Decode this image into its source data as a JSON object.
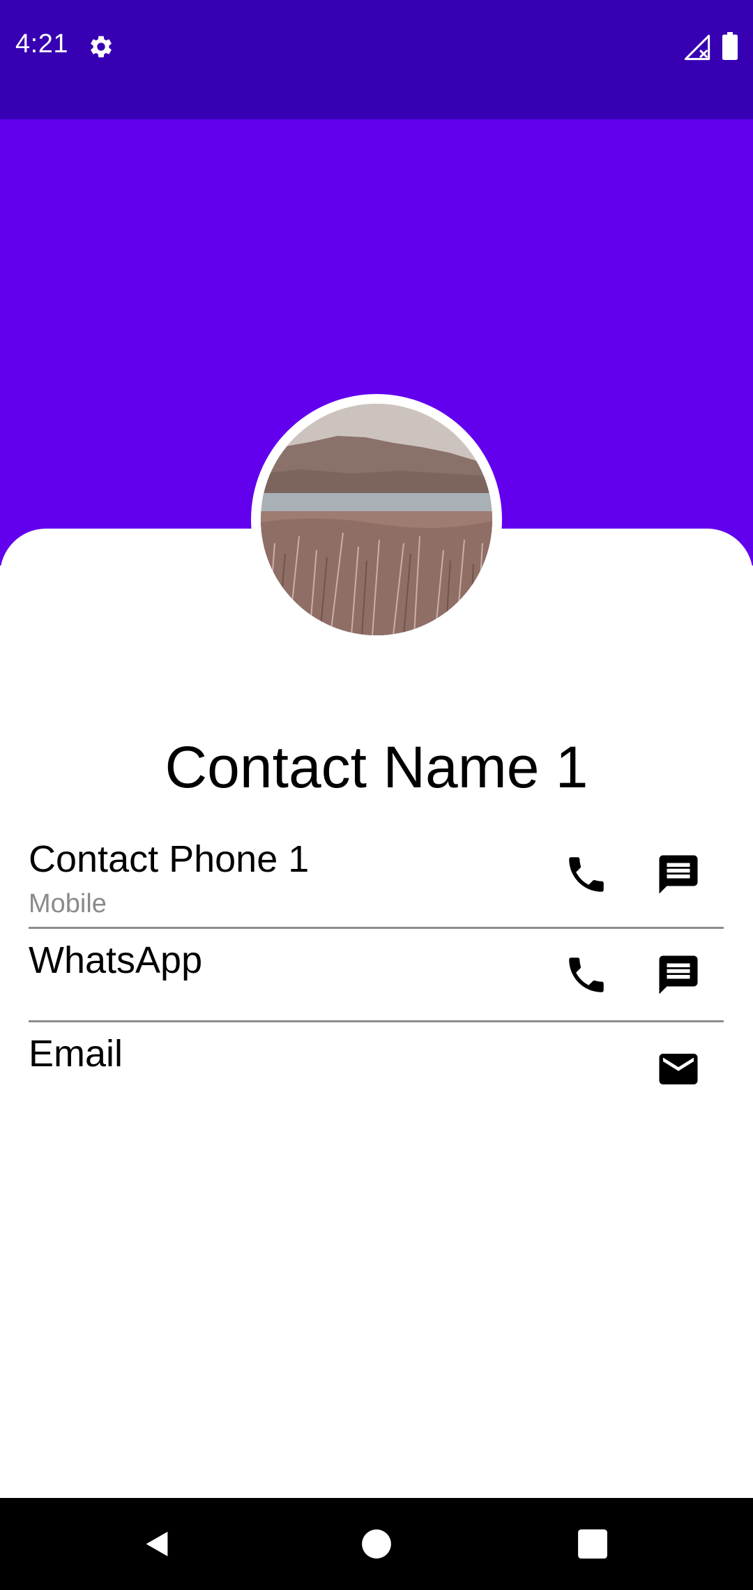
{
  "status_bar": {
    "time": "4:21",
    "icons": [
      "gear-icon",
      "signal-off-icon",
      "battery-icon"
    ]
  },
  "colors": {
    "status_bar": "#3700b3",
    "header": "#6200ee",
    "card": "#ffffff",
    "divider": "#8c8c8c",
    "subtitle": "#8a8a8a"
  },
  "contact": {
    "name": "Contact Name 1"
  },
  "rows": [
    {
      "title": "Contact Phone 1",
      "subtitle": "Mobile",
      "actions": [
        "phone-icon",
        "message-icon"
      ]
    },
    {
      "title": "WhatsApp",
      "actions": [
        "phone-icon",
        "message-icon"
      ]
    },
    {
      "title": "Email",
      "actions": [
        "email-icon"
      ]
    }
  ],
  "nav_bar": {
    "buttons": [
      "back-icon",
      "home-icon",
      "recents-icon"
    ]
  }
}
